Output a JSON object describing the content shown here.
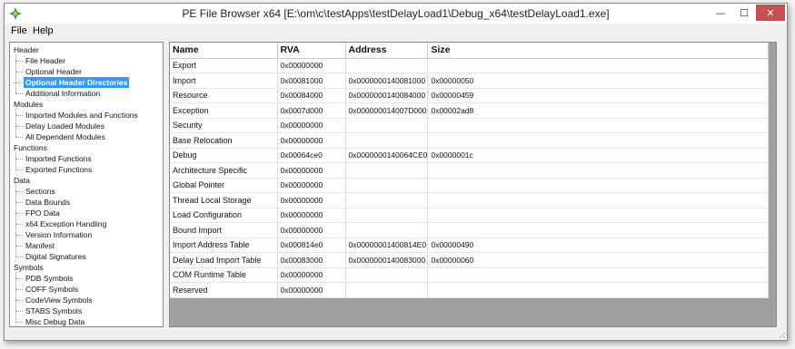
{
  "window": {
    "title": "PE File Browser x64 [E:\\om\\c\\testApps\\testDelayLoad1\\Debug_x64\\testDelayLoad1.exe]",
    "minimize_glyph": "—",
    "maximize_glyph": "☐",
    "close_glyph": "✕"
  },
  "menu": {
    "file": "File",
    "help": "Help"
  },
  "tree": [
    {
      "label": "Header",
      "level": 0
    },
    {
      "label": "File Header",
      "level": 1
    },
    {
      "label": "Optional Header",
      "level": 1
    },
    {
      "label": "Optional Header Directories",
      "level": 1,
      "selected": true
    },
    {
      "label": "Additional Information",
      "level": 1
    },
    {
      "label": "Modules",
      "level": 0
    },
    {
      "label": "Imported Modules and Functions",
      "level": 1
    },
    {
      "label": "Delay Loaded Modules",
      "level": 1
    },
    {
      "label": "All Dependent Modules",
      "level": 1
    },
    {
      "label": "Functions",
      "level": 0
    },
    {
      "label": "Imported Functions",
      "level": 1
    },
    {
      "label": "Exported Functions",
      "level": 1
    },
    {
      "label": "Data",
      "level": 0
    },
    {
      "label": "Sections",
      "level": 1
    },
    {
      "label": "Data Bounds",
      "level": 1
    },
    {
      "label": "FPO Data",
      "level": 1
    },
    {
      "label": "x64 Exception Handling",
      "level": 1
    },
    {
      "label": "Version Information",
      "level": 1
    },
    {
      "label": "Manifest",
      "level": 1
    },
    {
      "label": "Digital Signatures",
      "level": 1
    },
    {
      "label": "Symbols",
      "level": 0
    },
    {
      "label": "PDB Symbols",
      "level": 1
    },
    {
      "label": "COFF Symbols",
      "level": 1
    },
    {
      "label": "CodeView Symbols",
      "level": 1
    },
    {
      "label": "STABS Symbols",
      "level": 1
    },
    {
      "label": "Misc Debug Data",
      "level": 1
    }
  ],
  "table": {
    "columns": [
      "Name",
      "RVA",
      "Address",
      "Size"
    ],
    "rows": [
      [
        "Export",
        "0x00000000",
        "",
        ""
      ],
      [
        "Import",
        "0x00081000",
        "0x0000000140081000",
        "0x00000050"
      ],
      [
        "Resource",
        "0x00084000",
        "0x0000000140084000",
        "0x00000459"
      ],
      [
        "Exception",
        "0x0007d000",
        "0x000000014007D000",
        "0x00002ad8"
      ],
      [
        "Security",
        "0x00000000",
        "",
        ""
      ],
      [
        "Base Relocation",
        "0x00000000",
        "",
        ""
      ],
      [
        "Debug",
        "0x00064ce0",
        "0x0000000140064CE0",
        "0x0000001c"
      ],
      [
        "Architecture Specific",
        "0x00000000",
        "",
        ""
      ],
      [
        "Global Pointer",
        "0x00000000",
        "",
        ""
      ],
      [
        "Thread Local Storage",
        "0x00000000",
        "",
        ""
      ],
      [
        "Load Configuration",
        "0x00000000",
        "",
        ""
      ],
      [
        "Bound Import",
        "0x00000000",
        "",
        ""
      ],
      [
        "Import Address Table",
        "0x000814e0",
        "0x00000001400814E0",
        "0x00000490"
      ],
      [
        "Delay Load Import Table",
        "0x00083000",
        "0x0000000140083000",
        "0x00000060"
      ],
      [
        "COM Runtime Table",
        "0x00000000",
        "",
        ""
      ],
      [
        "Reserved",
        "0x00000000",
        "",
        ""
      ]
    ]
  }
}
